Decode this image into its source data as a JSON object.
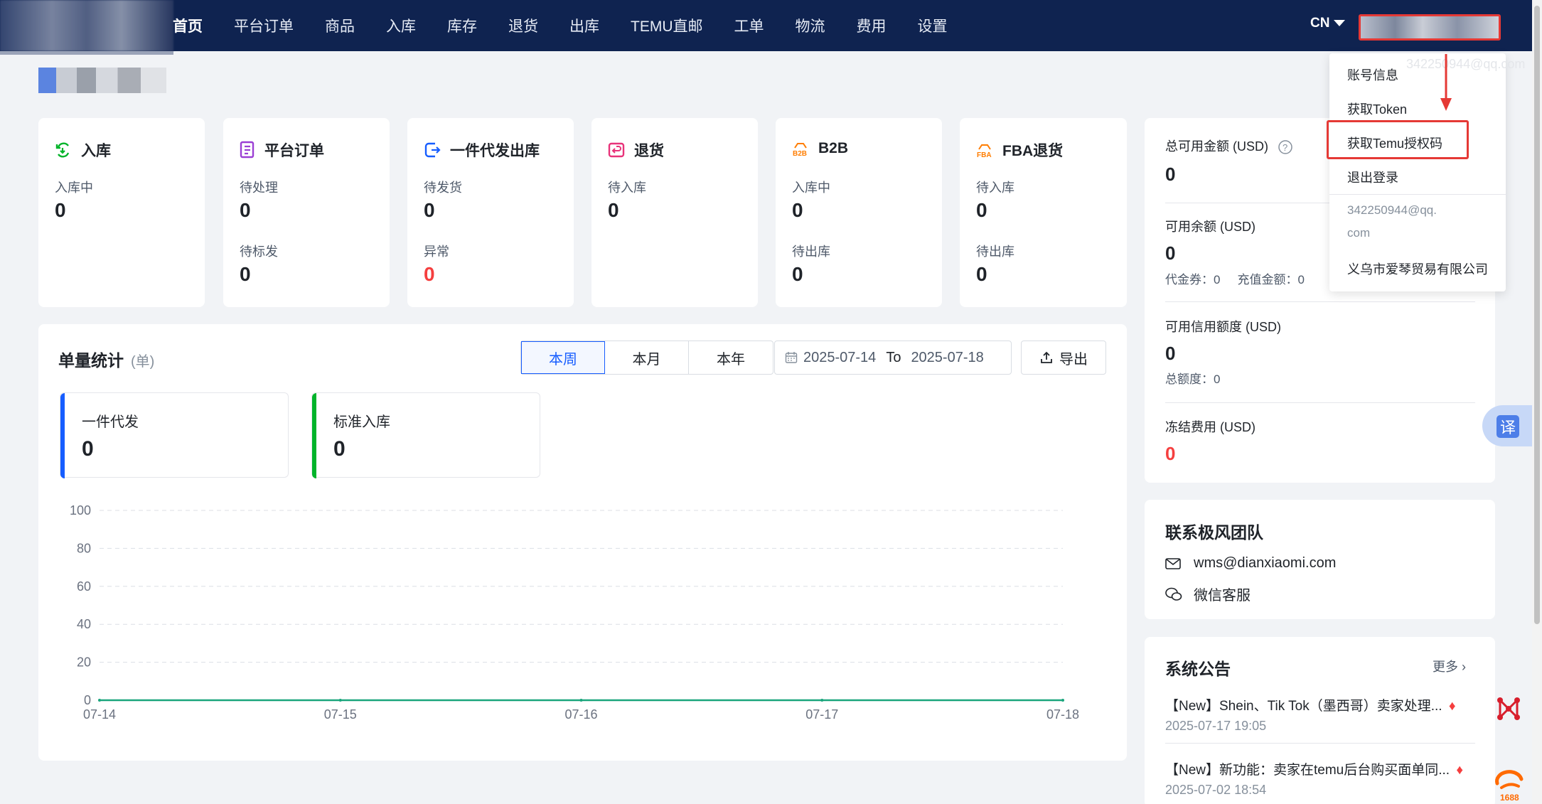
{
  "nav": {
    "items": [
      "首页",
      "平台订单",
      "商品",
      "入库",
      "库存",
      "退货",
      "出库",
      "TEMU直邮",
      "工单",
      "物流",
      "费用",
      "设置"
    ],
    "lang": "CN"
  },
  "dropdown": {
    "items": [
      "账号信息",
      "获取Token",
      "获取Temu授权码",
      "退出登录"
    ],
    "email_line1": "342250944@qq.",
    "email_line2": "com",
    "company": "义乌市爱琴贸易有限公司",
    "watermark": "342250944@qq.com"
  },
  "stats": [
    {
      "title": "入库",
      "icon": "inbound-icon",
      "color": "#00b42a",
      "rows": [
        {
          "label": "入库中",
          "value": "0"
        }
      ]
    },
    {
      "title": "平台订单",
      "icon": "order-icon",
      "color": "#9b3fd4",
      "rows": [
        {
          "label": "待处理",
          "value": "0"
        },
        {
          "label": "待标发",
          "value": "0"
        }
      ]
    },
    {
      "title": "一件代发出库",
      "icon": "outbound-icon",
      "color": "#165dff",
      "rows": [
        {
          "label": "待发货",
          "value": "0"
        },
        {
          "label": "异常",
          "value": "0"
        }
      ]
    },
    {
      "title": "退货",
      "icon": "return-icon",
      "color": "#e8337a",
      "rows": [
        {
          "label": "待入库",
          "value": "0"
        }
      ]
    },
    {
      "title": "B2B",
      "icon": "b2b-icon",
      "color": "#ff7d00",
      "rows": [
        {
          "label": "入库中",
          "value": "0"
        },
        {
          "label": "待出库",
          "value": "0"
        }
      ]
    },
    {
      "title": "FBA退货",
      "icon": "fba-icon",
      "color": "#ff7d00",
      "rows": [
        {
          "label": "待入库",
          "value": "0"
        },
        {
          "label": "待出库",
          "value": "0"
        }
      ]
    }
  ],
  "volume": {
    "title": "单量统计",
    "unit": "(单)",
    "tabs": [
      "本周",
      "本月",
      "本年"
    ],
    "date_from": "2025-07-14",
    "date_to_label": "To",
    "date_to": "2025-07-18",
    "export": "导出",
    "cards": [
      {
        "label": "一件代发",
        "value": "0",
        "color": "#165dff"
      },
      {
        "label": "标准入库",
        "value": "0",
        "color": "#00b42a"
      }
    ]
  },
  "chart_data": {
    "type": "line",
    "categories": [
      "07-14",
      "07-15",
      "07-16",
      "07-17",
      "07-18"
    ],
    "series": [
      {
        "values": [
          0,
          0,
          0,
          0,
          0
        ],
        "color": "#1aa57c"
      }
    ],
    "yticks": [
      "0",
      "20",
      "40",
      "60",
      "80",
      "100"
    ],
    "ylim": [
      0,
      100
    ],
    "grid": true
  },
  "funds": {
    "total_label": "总可用金额 (USD)",
    "total_value": "0",
    "available_label": "可用余额 (USD)",
    "available_value": "0",
    "voucher_label": "代金券：",
    "voucher_value": "0",
    "recharge_label": "充值金额：",
    "recharge_value": "0",
    "credit_label": "可用信用额度 (USD)",
    "credit_value": "0",
    "credit_total_label": "总额度：",
    "credit_total_value": "0",
    "frozen_label": "冻结费用 (USD)",
    "frozen_value": "0"
  },
  "contact": {
    "title": "联系极风团队",
    "email": "wms@dianxiaomi.com",
    "wechat": "微信客服"
  },
  "notice": {
    "title": "系统公告",
    "more": "更多",
    "items": [
      {
        "text": "【New】Shein、Tik Tok（墨西哥）卖家处理...",
        "time": "2025-07-17 19:05"
      },
      {
        "text": "【New】新功能：卖家在temu后台购买面单同...",
        "time": "2025-07-02 18:54"
      }
    ]
  },
  "float": {
    "translate": "译",
    "alibaba": "1688"
  }
}
